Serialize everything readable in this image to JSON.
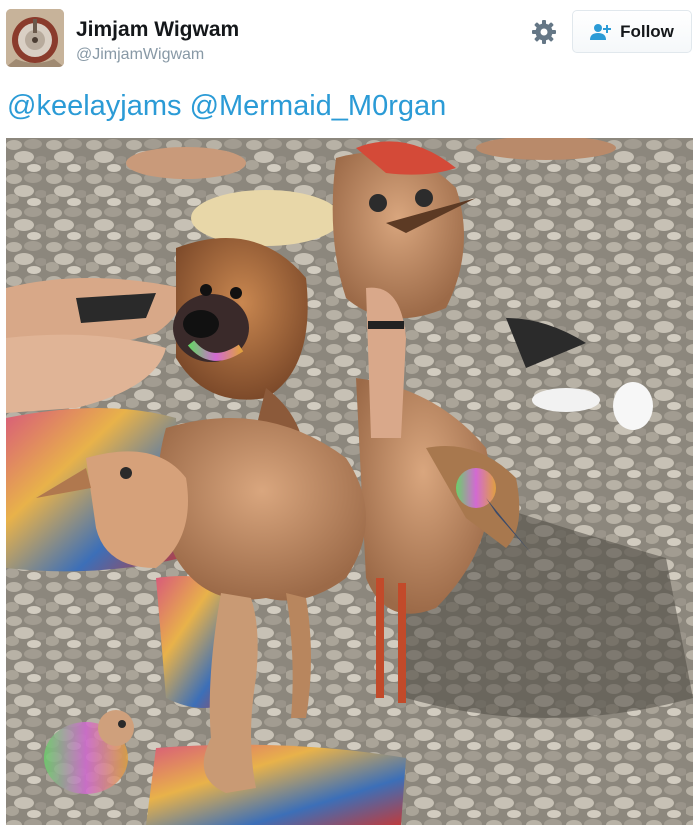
{
  "user": {
    "display_name": "Jimjam Wigwam",
    "handle": "@JimjamWigwam"
  },
  "actions": {
    "follow_label": "Follow",
    "settings_icon": "gear-icon",
    "follow_icon": "add-user-icon"
  },
  "tweet": {
    "mentions": [
      "@keelayjams",
      "@Mermaid_M0rgan"
    ]
  },
  "colors": {
    "mention": "#2b9bd6",
    "handle": "#8899a6",
    "name": "#14171a",
    "follow_icon": "#2b9bd6",
    "gear": "#657786"
  }
}
